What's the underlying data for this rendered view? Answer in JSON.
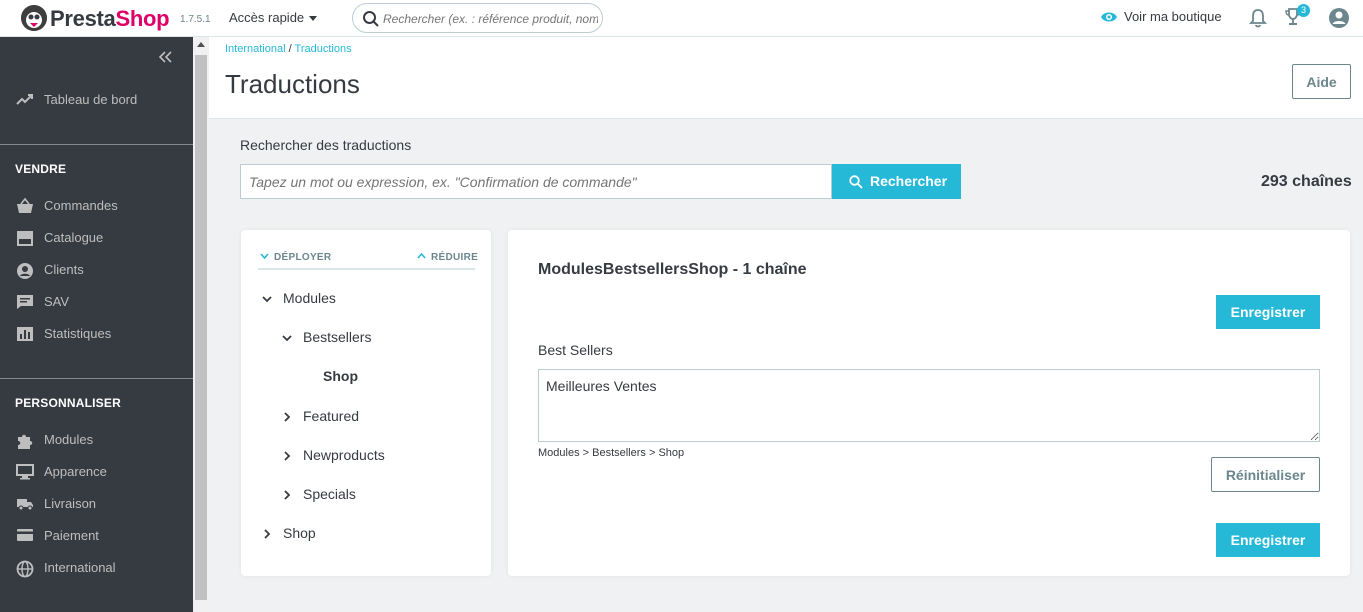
{
  "header": {
    "brand_prefix": "Presta",
    "brand_suffix": "Shop",
    "version": "1.7.5.1",
    "quick_access": "Accès rapide",
    "search_placeholder": "Rechercher (ex. : référence produit, nom",
    "view_shop": "Voir ma boutique",
    "notifications_badge": "3",
    "icons": [
      "search-icon",
      "eye-icon",
      "bell-icon",
      "trophy-icon",
      "user-icon"
    ]
  },
  "sidebar": {
    "dashboard": "Tableau de bord",
    "sell_title": "VENDRE",
    "sell_items": [
      "Commandes",
      "Catalogue",
      "Clients",
      "SAV",
      "Statistiques"
    ],
    "customize_title": "PERSONNALISER",
    "customize_items": [
      "Modules",
      "Apparence",
      "Livraison",
      "Paiement",
      "International"
    ]
  },
  "breadcrumb": {
    "parent": "International",
    "separator": "/",
    "current": "Traductions"
  },
  "page": {
    "title": "Traductions",
    "help_button": "Aide"
  },
  "search": {
    "label": "Rechercher des traductions",
    "placeholder": "Tapez un mot ou expression, ex. \"Confirmation de commande\"",
    "button": "Rechercher",
    "count": "293 chaînes"
  },
  "tree": {
    "expand": "DÉPLOYER",
    "collapse": "RÉDUIRE",
    "nodes": {
      "modules": "Modules",
      "bestsellers": "Bestsellers",
      "shop_active": "Shop",
      "featured": "Featured",
      "newproducts": "Newproducts",
      "specials": "Specials",
      "shop": "Shop"
    }
  },
  "editor": {
    "title": "ModulesBestsellersShop - 1 chaîne",
    "save_button": "Enregistrer",
    "field_label": "Best Sellers",
    "field_value": "Meilleures Ventes",
    "path": "Modules > Bestsellers > Shop",
    "reset_button": "Réinitialiser"
  },
  "colors": {
    "accent": "#25b9d7",
    "brand_pink": "#df0067",
    "sidebar_bg": "#363a41"
  }
}
